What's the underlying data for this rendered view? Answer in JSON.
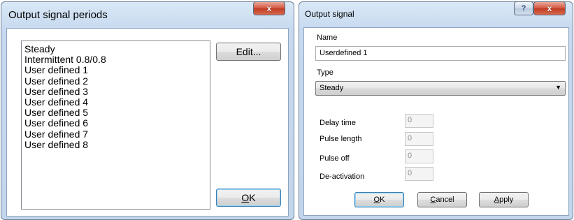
{
  "periods_dialog": {
    "title": "Output signal periods",
    "list_items": [
      "Steady",
      "Intermittent 0.8/0.8",
      "User defined 1",
      "User defined 2",
      "User defined 3",
      "User defined 4",
      "User defined 5",
      "User defined 6",
      "User defined 7",
      "User defined 8"
    ],
    "edit_label": "Edit...",
    "ok_accel": "O",
    "ok_rest": "K",
    "close_glyph": "x"
  },
  "signal_dialog": {
    "title": "Output signal",
    "help_glyph": "?",
    "close_glyph": "x",
    "name_label": "Name",
    "name_value": "Userdefined 1",
    "type_label": "Type",
    "type_value": "Steady",
    "delay_label": "Delay time",
    "delay_value": "0",
    "pulse_length_label": "Pulse length",
    "pulse_length_value": "0",
    "pulse_off_label": "Pulse off",
    "pulse_off_value": "0",
    "deactivation_label": "De-activation",
    "deactivation_value": "0",
    "ok_accel": "O",
    "ok_rest": "K",
    "cancel_accel": "C",
    "cancel_rest": "ancel",
    "apply_accel": "A",
    "apply_rest": "pply"
  },
  "colors": {
    "frame": "#c6d9ef",
    "close_button": "#c13a22",
    "default_button_border": "#3c7fb1"
  }
}
